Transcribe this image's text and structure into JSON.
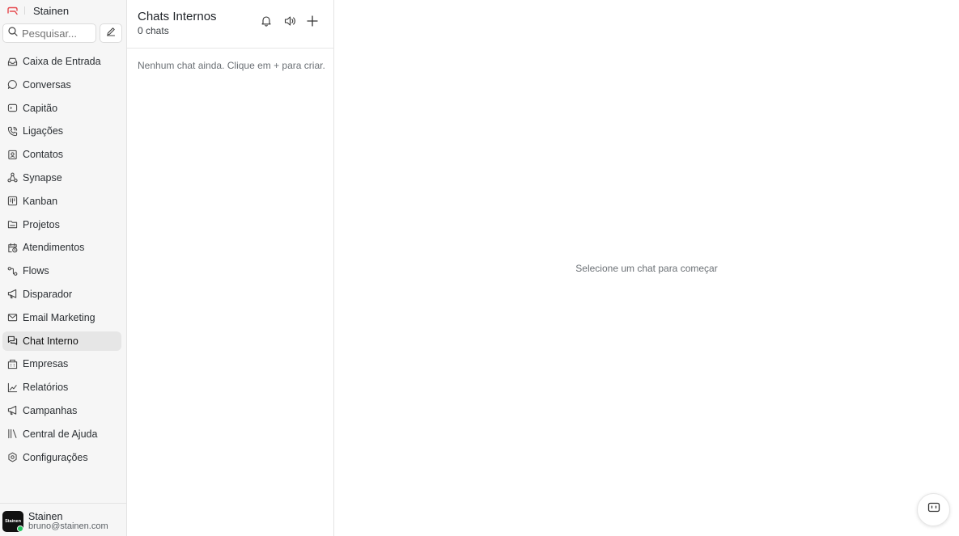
{
  "brand": {
    "name": "Stainen",
    "accent": "#e5484d"
  },
  "search": {
    "placeholder": "Pesquisar..."
  },
  "sidebar": {
    "items": [
      {
        "label": "Caixa de Entrada",
        "icon": "inbox-icon"
      },
      {
        "label": "Conversas",
        "icon": "message-circle-icon"
      },
      {
        "label": "Capitão",
        "icon": "bot-card-icon"
      },
      {
        "label": "Ligações",
        "icon": "phone-icon"
      },
      {
        "label": "Contatos",
        "icon": "contact-icon"
      },
      {
        "label": "Synapse",
        "icon": "network-icon"
      },
      {
        "label": "Kanban",
        "icon": "kanban-icon"
      },
      {
        "label": "Projetos",
        "icon": "folder-icon"
      },
      {
        "label": "Atendimentos",
        "icon": "calendar-clock-icon"
      },
      {
        "label": "Flows",
        "icon": "flow-icon"
      },
      {
        "label": "Disparador",
        "icon": "megaphone-icon"
      },
      {
        "label": "Email Marketing",
        "icon": "mail-icon"
      },
      {
        "label": "Chat Interno",
        "icon": "messages-square-icon",
        "active": true
      },
      {
        "label": "Empresas",
        "icon": "building-icon"
      },
      {
        "label": "Relatórios",
        "icon": "chart-line-icon"
      },
      {
        "label": "Campanhas",
        "icon": "megaphone-icon"
      },
      {
        "label": "Central de Ajuda",
        "icon": "library-icon"
      },
      {
        "label": "Configurações",
        "icon": "settings-icon"
      }
    ]
  },
  "user": {
    "name": "Stainen",
    "email": "bruno@stainen.com",
    "avatar_text": "Stainen",
    "status_color": "#22c55e"
  },
  "chat_list": {
    "title": "Chats Internos",
    "count": "0 chats",
    "empty_text": "Nenhum chat ainda. Clique em + para criar."
  },
  "main": {
    "empty_text": "Selecione um chat para começar"
  }
}
